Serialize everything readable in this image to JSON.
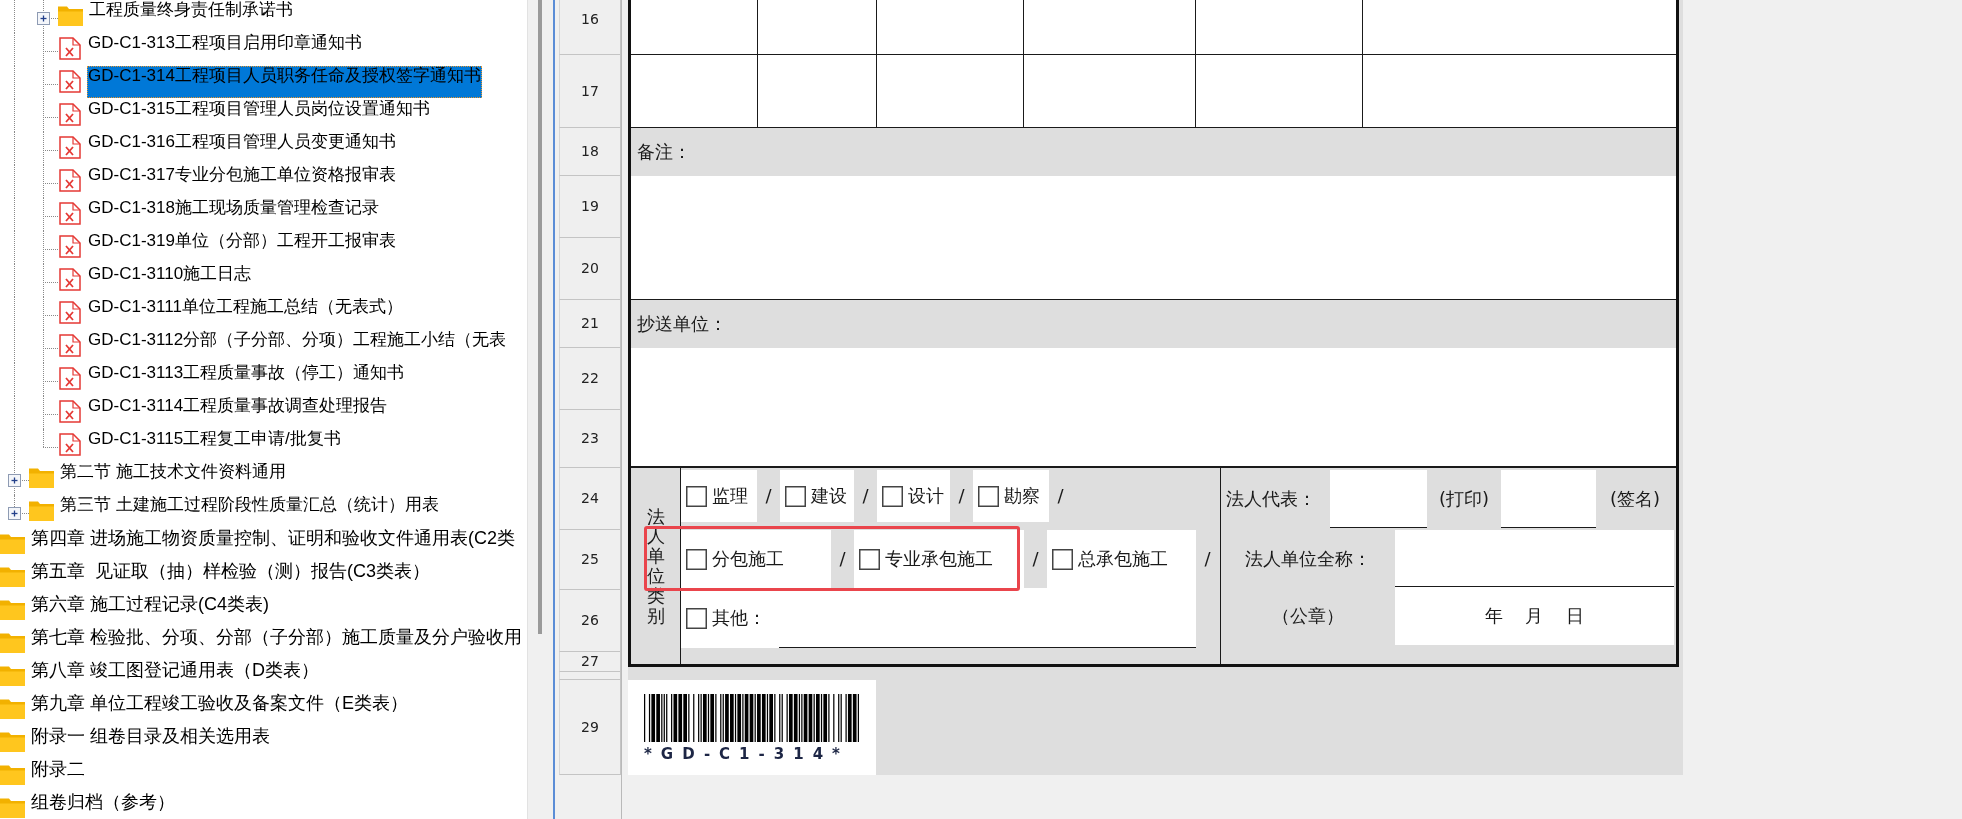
{
  "tree": {
    "items": [
      {
        "children": [
          {
            "children": [
              {
                "label": "工程质量终身责任制承诺书",
                "kind": "folder",
                "expanded": false,
                "selected": false
              },
              {
                "label": "GD-C1-313工程项目启用印章通知书",
                "kind": "file",
                "selected": false
              },
              {
                "label": "GD-C1-314工程项目人员职务任命及授权签字通知书",
                "kind": "file",
                "selected": true
              },
              {
                "label": "GD-C1-315工程项目管理人员岗位设置通知书",
                "kind": "file",
                "selected": false
              },
              {
                "label": "GD-C1-316工程项目管理人员变更通知书",
                "kind": "file",
                "selected": false
              },
              {
                "label": "GD-C1-317专业分包施工单位资格报审表",
                "kind": "file",
                "selected": false
              },
              {
                "label": "GD-C1-318施工现场质量管理检查记录",
                "kind": "file",
                "selected": false
              },
              {
                "label": "GD-C1-319单位（分部）工程开工报审表",
                "kind": "file",
                "selected": false
              },
              {
                "label": "GD-C1-3110施工日志",
                "kind": "file",
                "selected": false
              },
              {
                "label": "GD-C1-3111单位工程施工总结（无表式）",
                "kind": "file",
                "selected": false
              },
              {
                "label": "GD-C1-3112分部（子分部、分项）工程施工小结（无表",
                "kind": "file",
                "selected": false
              },
              {
                "label": "GD-C1-3113工程质量事故（停工）通知书",
                "kind": "file",
                "selected": false
              },
              {
                "label": "GD-C1-3114工程质量事故调查处理报告",
                "kind": "file",
                "selected": false
              },
              {
                "label": "GD-C1-3115工程复工申请/批复书",
                "kind": "file",
                "selected": false
              }
            ]
          },
          {
            "label": "第二节 施工技术文件资料通用",
            "kind": "folder",
            "expanded": false,
            "selected": false
          },
          {
            "label": "第三节 土建施工过程阶段性质量汇总（统计）用表",
            "kind": "folder",
            "expanded": false,
            "selected": false
          }
        ]
      },
      {
        "label": "第四章 进场施工物资质量控制、证明和验收文件通用表(C2类",
        "kind": "folder",
        "selected": false
      },
      {
        "label": "第五章  见证取（抽）样检验（测）报告(C3类表）",
        "kind": "folder",
        "selected": false
      },
      {
        "label": "第六章 施工过程记录(C4类表)",
        "kind": "folder",
        "selected": false
      },
      {
        "label": "第七章 检验批、分项、分部（子分部）施工质量及分户验收用",
        "kind": "folder",
        "selected": false
      },
      {
        "label": "第八章 竣工图登记通用表（D类表）",
        "kind": "folder",
        "selected": false
      },
      {
        "label": "第九章 单位工程竣工验收及备案文件（E类表）",
        "kind": "folder",
        "selected": false
      },
      {
        "label": "附录一 组卷目录及相关选用表",
        "kind": "folder",
        "selected": false
      },
      {
        "label": "附录二",
        "kind": "folder",
        "selected": false
      },
      {
        "label": "组卷归档（参考）",
        "kind": "folder",
        "selected": false
      }
    ]
  },
  "sheet": {
    "row_headers": [
      "16",
      "17",
      "18",
      "19",
      "20",
      "21",
      "22",
      "23",
      "24",
      "25",
      "26",
      "27",
      "29"
    ],
    "remarks_label": "备注：",
    "cc_label": "抄送单位：",
    "unit_type": {
      "label": "法人单位类别",
      "option_rows": [
        [
          {
            "label": "监理",
            "checked": false,
            "highlighted": false,
            "separator": "/"
          },
          {
            "label": "建设",
            "checked": false,
            "highlighted": false,
            "separator": "/"
          },
          {
            "label": "设计",
            "checked": false,
            "highlighted": false,
            "separator": "/"
          },
          {
            "label": "勘察",
            "checked": false,
            "highlighted": false,
            "separator": "/"
          }
        ],
        [
          {
            "label": "分包施工",
            "checked": false,
            "highlighted": true,
            "separator": "/"
          },
          {
            "label": "专业承包施工",
            "checked": false,
            "highlighted": true,
            "separator": "/"
          },
          {
            "label": "总承包施工",
            "checked": false,
            "highlighted": false,
            "separator": "/"
          }
        ]
      ],
      "other_option": {
        "label": "其他：",
        "checked": false
      }
    },
    "legal_rep": {
      "label": "法人代表：",
      "print_note": "(打印)",
      "sign_note": "(签名)"
    },
    "unit_name_label": "法人单位全称：",
    "seal_note": "（公章）",
    "date_text": "年    月    日",
    "barcode": {
      "caption": "*GD-C1-314*"
    }
  }
}
